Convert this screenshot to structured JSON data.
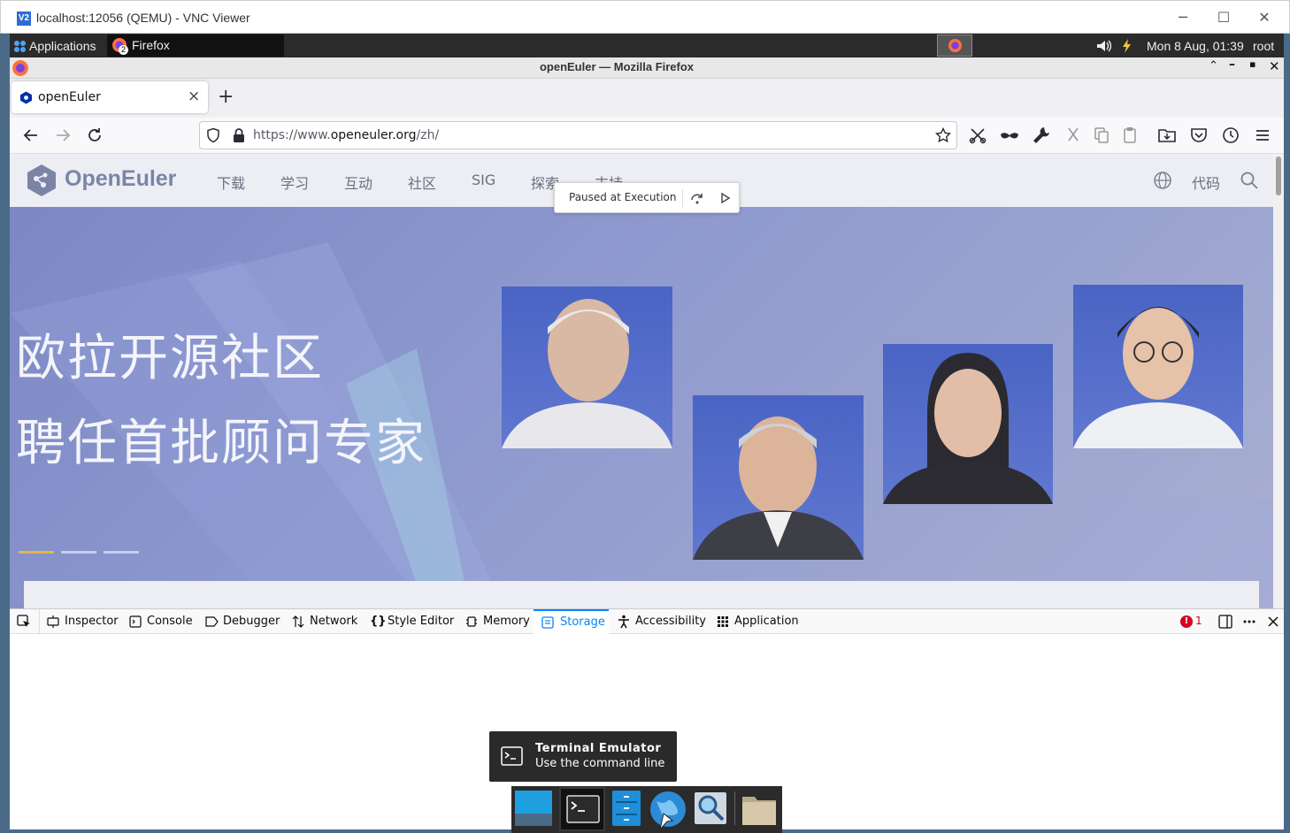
{
  "vnc": {
    "icon_text": "V2",
    "title": "localhost:12056 (QEMU) - VNC Viewer",
    "minimize": "─",
    "maximize": "☐",
    "close": "✕"
  },
  "panel": {
    "applications": "Applications",
    "taskbar_app": "Firefox",
    "taskbar_badge": "2",
    "clock": "Mon  8 Aug, 01:39",
    "user": "root"
  },
  "firefox": {
    "window_title": "openEuler — Mozilla Firefox",
    "tab_title": "openEuler",
    "tab_close": "×",
    "new_tab": "+",
    "url_prefix": "https://www.",
    "url_host": "openeuler.org",
    "url_path": "/zh/"
  },
  "site": {
    "logo_text": "OpenEuler",
    "nav": [
      "下载",
      "学习",
      "互动",
      "社区",
      "SIG",
      "探索",
      "支持"
    ],
    "code_link": "代码",
    "hero_line1": "欧拉开源社区",
    "hero_line2": "聘任首批顾问专家"
  },
  "debugger_overlay": {
    "label": "Paused at Execution"
  },
  "devtools": {
    "tabs": [
      "Inspector",
      "Console",
      "Debugger",
      "Network",
      "Style Editor",
      "Memory",
      "Storage",
      "Accessibility",
      "Application"
    ],
    "selected_tab": "Storage",
    "error_count": "1"
  },
  "dock": {
    "tooltip_title": "Terminal Emulator",
    "tooltip_subtitle": "Use the command line"
  },
  "colors": {
    "accent": "#0a84ff",
    "panel_bg": "#2b2b2b",
    "hero_bg": "#8e99cf",
    "error_red": "#d70022"
  }
}
